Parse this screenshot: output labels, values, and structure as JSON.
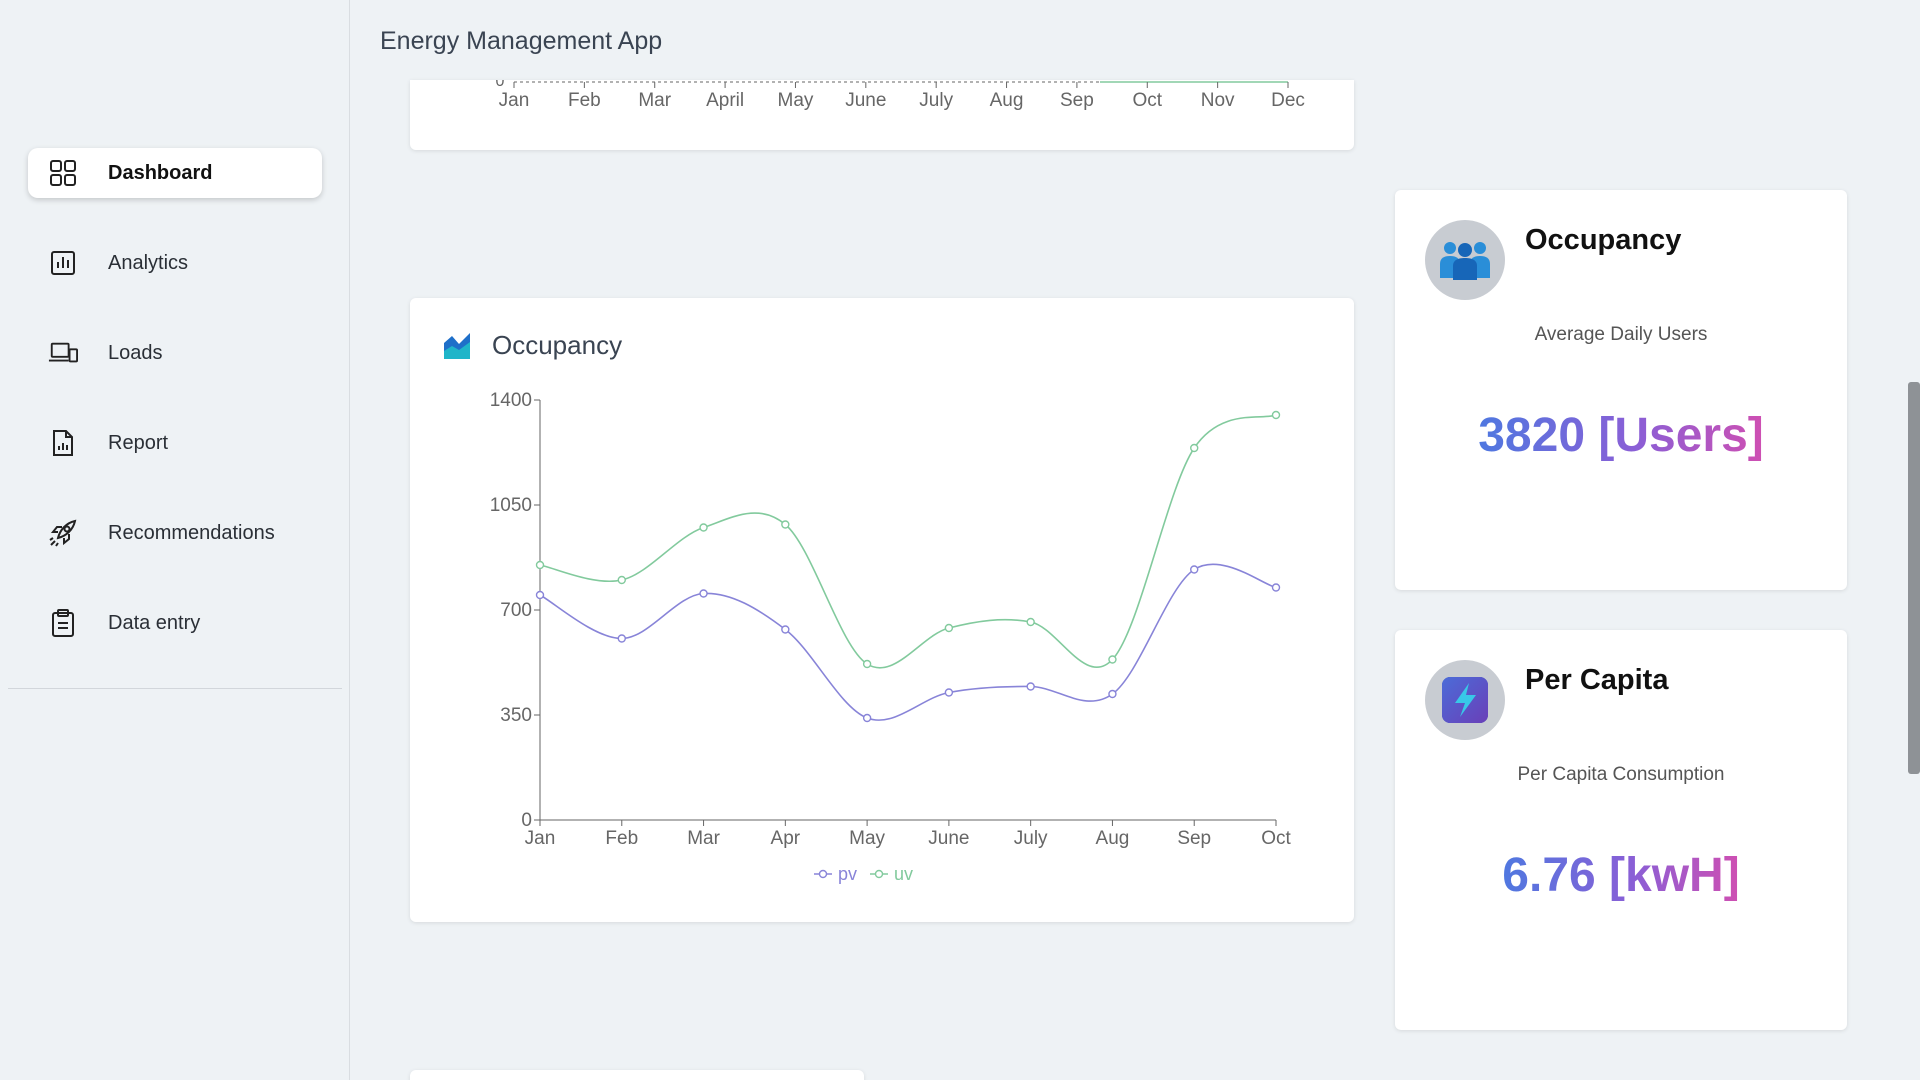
{
  "app": {
    "title": "Energy Management App"
  },
  "sidebar": {
    "items": [
      {
        "label": "Dashboard",
        "icon": "dashboard-grid-icon",
        "active": true
      },
      {
        "label": "Analytics",
        "icon": "bar-chart-icon",
        "active": false
      },
      {
        "label": "Loads",
        "icon": "devices-icon",
        "active": false
      },
      {
        "label": "Report",
        "icon": "document-chart-icon",
        "active": false
      },
      {
        "label": "Recommendations",
        "icon": "rocket-icon",
        "active": false
      },
      {
        "label": "Data entry",
        "icon": "clipboard-icon",
        "active": false
      }
    ]
  },
  "top_chart": {
    "x_ticks": [
      "Jan",
      "Feb",
      "Mar",
      "April",
      "May",
      "June",
      "July",
      "Aug",
      "Sep",
      "Oct",
      "Nov",
      "Dec"
    ],
    "y_tick_visible": "0",
    "series_color": "#82ca9d"
  },
  "occupancy_chart": {
    "title": "Occupancy",
    "icon": "area-chart-icon"
  },
  "chart_data": {
    "type": "line",
    "title": "Occupancy",
    "categories": [
      "Jan",
      "Feb",
      "Mar",
      "Apr",
      "May",
      "June",
      "July",
      "Aug",
      "Sep",
      "Oct"
    ],
    "series": [
      {
        "name": "pv",
        "color": "#8884d8",
        "values": [
          750,
          605,
          755,
          635,
          340,
          425,
          445,
          420,
          835,
          775
        ]
      },
      {
        "name": "uv",
        "color": "#82ca9d",
        "values": [
          850,
          800,
          975,
          985,
          520,
          640,
          660,
          535,
          1240,
          1350
        ]
      }
    ],
    "yticks": [
      "0",
      "350",
      "700",
      "1050",
      "1400"
    ],
    "ylim": [
      0,
      1400
    ],
    "legend_position": "bottom-center",
    "grid": false
  },
  "stats": {
    "occupancy": {
      "title": "Occupancy",
      "subtitle": "Average Daily Users",
      "value": "3820 [Users]",
      "icon": "users-group-icon"
    },
    "per_capita": {
      "title": "Per Capita",
      "subtitle": "Per Capita Consumption",
      "value": "6.76 [kwH]",
      "icon": "lightning-bolt-icon"
    }
  }
}
